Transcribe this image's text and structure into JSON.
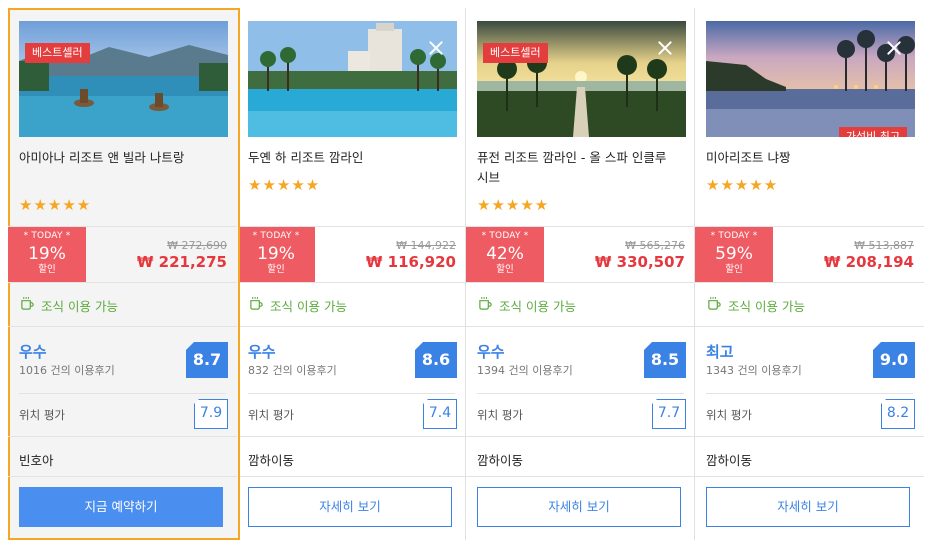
{
  "hotels": [
    {
      "badge": "베스트셀러",
      "name": "아미아나 리조트 앤 빌라 나트랑",
      "stars": "★★★★★",
      "today_label": "* TODAY *",
      "discount_pct": "19%",
      "discount_label": "할인",
      "original_price": "₩ 272,690",
      "final_price": "₩ 221,275",
      "breakfast": "조식 이용 가능",
      "grade": "우수",
      "review_count": "1016 건의 이용후기",
      "score": "8.7",
      "location_label": "위치 평가",
      "location_score": "7.9",
      "area": "빈호아",
      "button": "지금 예약하기"
    },
    {
      "name": "두옌 하 리조트 깜라인",
      "stars": "★★★★★",
      "today_label": "* TODAY *",
      "discount_pct": "19%",
      "discount_label": "할인",
      "original_price": "₩ 144,922",
      "final_price": "₩ 116,920",
      "breakfast": "조식 이용 가능",
      "grade": "우수",
      "review_count": "832 건의 이용후기",
      "score": "8.6",
      "location_label": "위치 평가",
      "location_score": "7.4",
      "area": "깜하이동",
      "button": "자세히 보기"
    },
    {
      "badge": "베스트셀러",
      "name": "퓨전 리조트 깜라인 - 올 스파 인클루시브",
      "stars": "★★★★★",
      "today_label": "* TODAY *",
      "discount_pct": "42%",
      "discount_label": "할인",
      "original_price": "₩ 565,276",
      "final_price": "₩ 330,507",
      "breakfast": "조식 이용 가능",
      "grade": "우수",
      "review_count": "1394 건의 이용후기",
      "score": "8.5",
      "location_label": "위치 평가",
      "location_score": "7.7",
      "area": "깜하이동",
      "button": "자세히 보기"
    },
    {
      "corner_badge": "가성비 최고",
      "name": "미아리조트 냐짱",
      "stars": "★★★★★",
      "today_label": "* TODAY *",
      "discount_pct": "59%",
      "discount_label": "할인",
      "original_price": "₩ 513,887",
      "final_price": "₩ 208,194",
      "breakfast": "조식 이용 가능",
      "grade": "최고",
      "review_count": "1343 건의 이용후기",
      "score": "9.0",
      "location_label": "위치 평가",
      "location_score": "8.2",
      "area": "깜하이동",
      "button": "자세히 보기"
    }
  ],
  "colors": {
    "accent_blue": "#3b82e5",
    "sale_red": "#ef5b63",
    "badge_red": "#e43d3d",
    "breakfast_green": "#5bab3c",
    "star_gold": "#f5a623",
    "selected_border": "#f5a623"
  },
  "icons": {
    "close": "close-icon",
    "breakfast": "coffee-cup-icon",
    "star": "star-icon"
  }
}
